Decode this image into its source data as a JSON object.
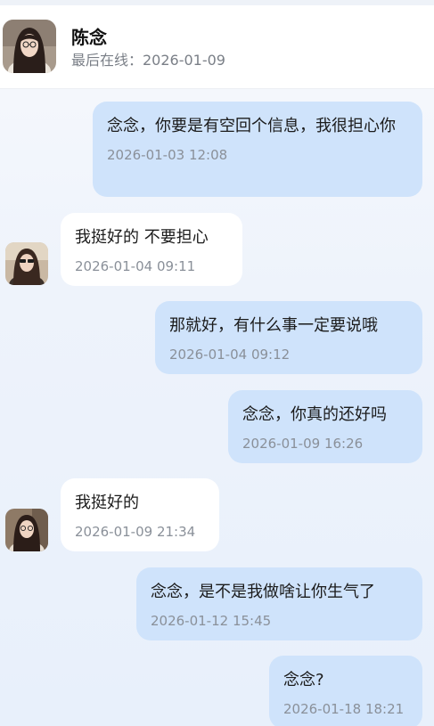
{
  "header": {
    "name": "陈念",
    "status": "最后在线：2026-01-09"
  },
  "messages": [
    {
      "side": "out",
      "text": "念念，你要是有空回个信息，我很担心你",
      "time": "2026-01-03 12:08"
    },
    {
      "side": "in",
      "text": "我挺好的 不要担心",
      "time": "2026-01-04 09:11"
    },
    {
      "side": "out",
      "text": "那就好，有什么事一定要说哦",
      "time": "2026-01-04 09:12"
    },
    {
      "side": "out",
      "text": "念念，你真的还好吗",
      "time": "2026-01-09 16:26"
    },
    {
      "side": "in",
      "text": "我挺好的",
      "time": "2026-01-09 21:34"
    },
    {
      "side": "out",
      "text": "念念，是不是我做啥让你生气了",
      "time": "2026-01-12 15:45"
    },
    {
      "side": "out",
      "text": "念念?",
      "time": "2026-01-18 18:21"
    }
  ],
  "colors": {
    "outgoing_bubble": "#cfe3fb",
    "incoming_bubble": "#ffffff",
    "timestamp": "#8a9099"
  }
}
